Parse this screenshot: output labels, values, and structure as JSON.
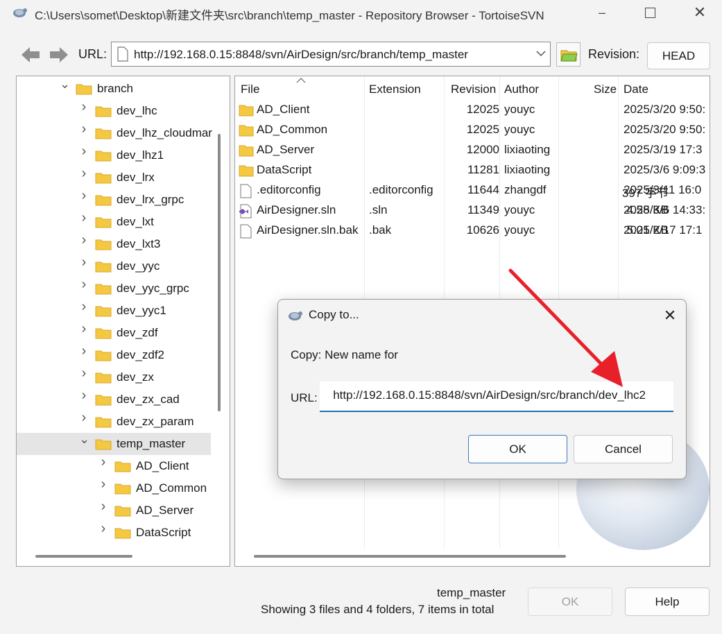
{
  "window": {
    "title": "C:\\Users\\somet\\Desktop\\新建文件夹\\src\\branch\\temp_master - Repository Browser - TortoiseSVN",
    "minimize_icon": "minimize-icon",
    "maximize_icon": "maximize-icon",
    "close_icon": "close-icon"
  },
  "toolbar": {
    "url_label": "URL:",
    "url_value": "http://192.168.0.15:8848/svn/AirDesign/src/branch/temp_master",
    "revision_label": "Revision:",
    "revision_button": "HEAD"
  },
  "tree": {
    "items": [
      {
        "label": "branch",
        "level": 0,
        "expanded": true
      },
      {
        "label": "dev_lhc",
        "level": 1
      },
      {
        "label": "dev_lhz_cloudmar",
        "level": 1
      },
      {
        "label": "dev_lhz1",
        "level": 1
      },
      {
        "label": "dev_lrx",
        "level": 1
      },
      {
        "label": "dev_lrx_grpc",
        "level": 1
      },
      {
        "label": "dev_lxt",
        "level": 1
      },
      {
        "label": "dev_lxt3",
        "level": 1
      },
      {
        "label": "dev_yyc",
        "level": 1
      },
      {
        "label": "dev_yyc_grpc",
        "level": 1
      },
      {
        "label": "dev_yyc1",
        "level": 1
      },
      {
        "label": "dev_zdf",
        "level": 1
      },
      {
        "label": "dev_zdf2",
        "level": 1
      },
      {
        "label": "dev_zx",
        "level": 1
      },
      {
        "label": "dev_zx_cad",
        "level": 1
      },
      {
        "label": "dev_zx_param",
        "level": 1
      },
      {
        "label": "temp_master",
        "level": 1,
        "expanded": true,
        "selected": true
      },
      {
        "label": "AD_Client",
        "level": 2
      },
      {
        "label": "AD_Common",
        "level": 2
      },
      {
        "label": "AD_Server",
        "level": 2
      },
      {
        "label": "DataScript",
        "level": 2
      }
    ]
  },
  "list": {
    "columns": [
      "File",
      "Extension",
      "Revision",
      "Author",
      "Size",
      "Date"
    ],
    "rows": [
      {
        "icon": "folder-icon",
        "file": "AD_Client",
        "ext": "",
        "rev": "12025",
        "author": "youyc",
        "size": "",
        "date": "2025/3/20 9:50:"
      },
      {
        "icon": "folder-icon",
        "file": "AD_Common",
        "ext": "",
        "rev": "12025",
        "author": "youyc",
        "size": "",
        "date": "2025/3/20 9:50:"
      },
      {
        "icon": "folder-icon",
        "file": "AD_Server",
        "ext": "",
        "rev": "12000",
        "author": "lixiaoting",
        "size": "",
        "date": "2025/3/19 17:3"
      },
      {
        "icon": "folder-icon",
        "file": "DataScript",
        "ext": "",
        "rev": "11281",
        "author": "lixiaoting",
        "size": "",
        "date": "2025/3/6 9:09:3"
      },
      {
        "icon": "file-icon",
        "file": ".editorconfig",
        "ext": ".editorconfig",
        "rev": "11644",
        "author": "zhangdf",
        "size": "397 字节",
        "date": "2025/3/11 16:0"
      },
      {
        "icon": "visual-studio-icon",
        "file": "AirDesigner.sln",
        "ext": ".sln",
        "rev": "11349",
        "author": "youyc",
        "size": "4.58 KB",
        "date": "2025/3/6 14:33:"
      },
      {
        "icon": "file-icon",
        "file": "AirDesigner.sln.bak",
        "ext": ".bak",
        "rev": "10626",
        "author": "youyc",
        "size": "5.01 KB",
        "date": "2025/2/17 17:1"
      }
    ]
  },
  "status": {
    "path": "temp_master",
    "summary": "Showing 3 files and 4 folders, 7 items in total"
  },
  "buttons": {
    "ok": "OK",
    "help": "Help"
  },
  "dialog": {
    "title": "Copy to...",
    "prompt": "Copy: New name for",
    "url_label": "URL:",
    "url_value": "http://192.168.0.15:8848/svn/AirDesign/src/branch/dev_lhc2",
    "ok": "OK",
    "cancel": "Cancel"
  },
  "colors": {
    "accent": "#1f6fb5",
    "folder": "#f5c842",
    "annotation_arrow": "#e8202a"
  }
}
